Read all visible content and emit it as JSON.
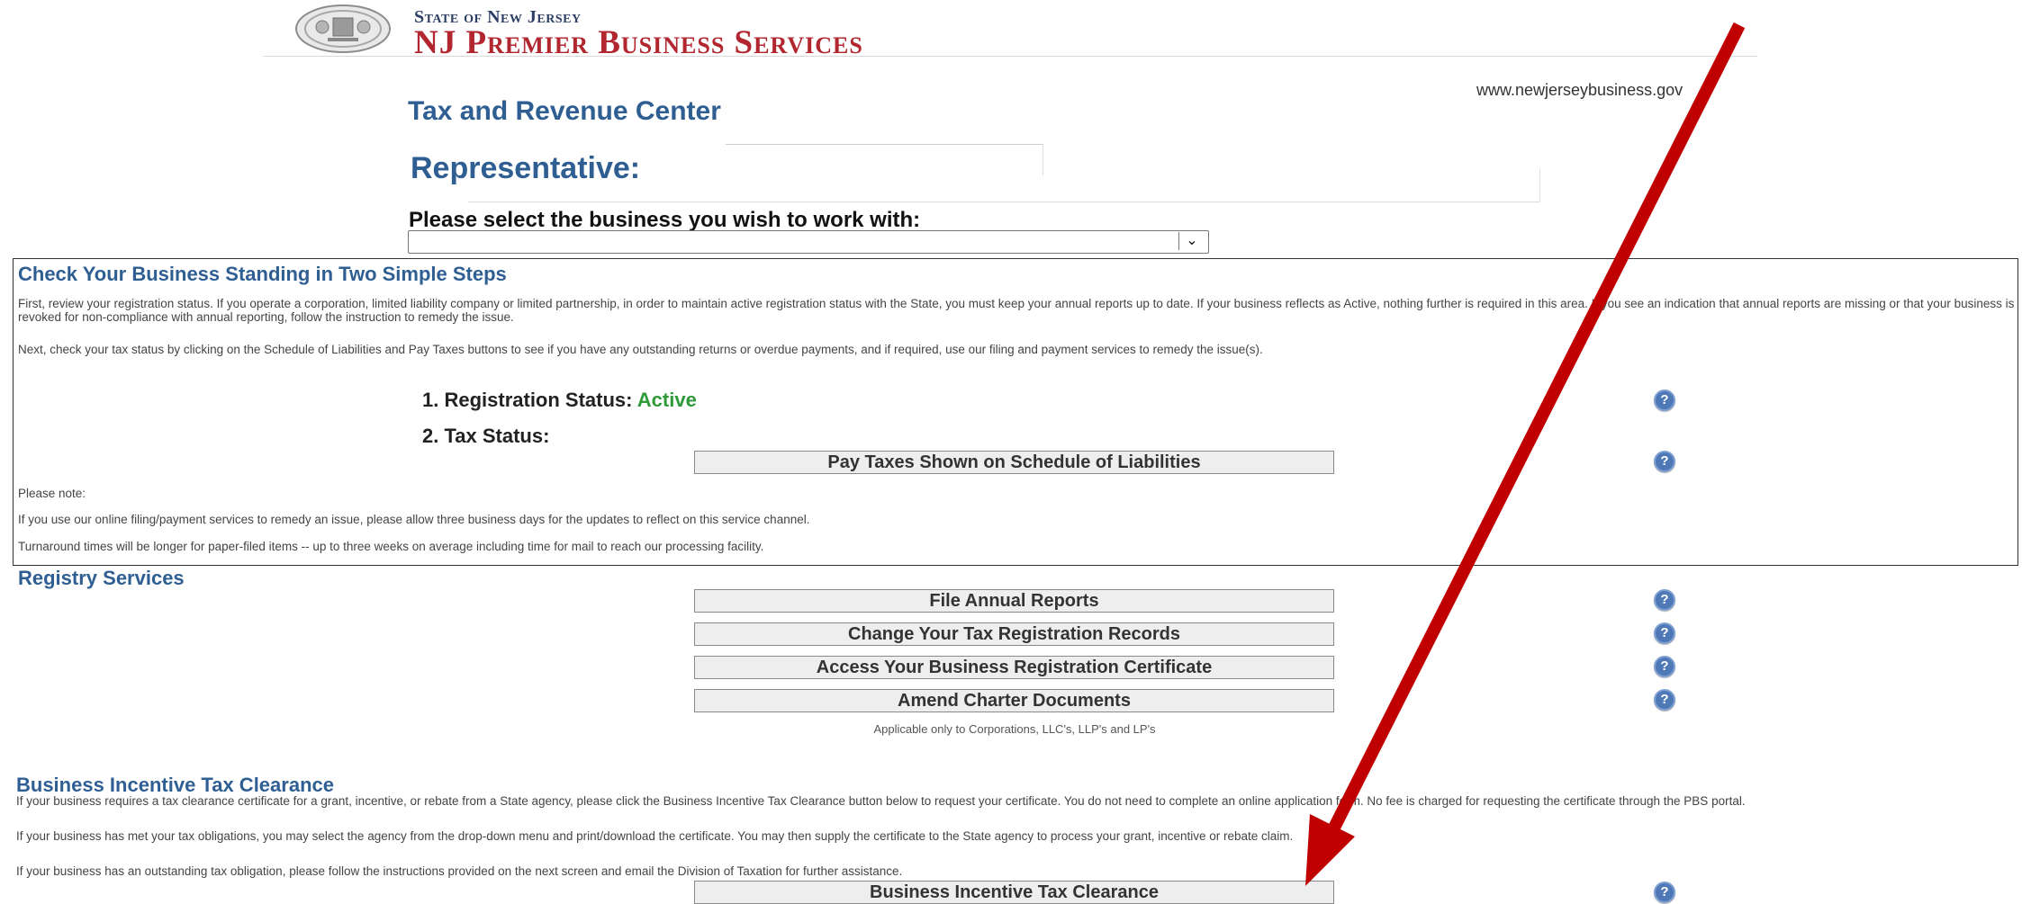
{
  "header": {
    "state_label": "State of New Jersey",
    "brand_label": "NJ Premier Business Services",
    "website": "www.newjerseybusiness.gov"
  },
  "page": {
    "title": "Tax and Revenue Center",
    "representative_label": "Representative:",
    "select_business_label": "Please select the business you wish to work with:",
    "select_value": ""
  },
  "standing": {
    "title": "Check Your Business Standing in Two Simple Steps",
    "para1": "First, review your registration status. If you operate a corporation, limited liability company or limited partnership, in order to maintain active registration status with the State, you must keep your annual reports up to date. If your business reflects as Active, nothing further is required in this area. If you see an indication that annual reports are missing or that your business is revoked for non-compliance with annual reporting, follow the instruction to remedy the issue.",
    "para2": "Next, check your tax status by clicking on the Schedule of Liabilities and Pay Taxes buttons to see if you have any outstanding returns or overdue payments, and if required, use our filing and payment services to remedy the issue(s).",
    "step1_label": "1. Registration Status:",
    "step1_value": "Active",
    "step2_label": "2. Tax Status:",
    "pay_taxes_button": "Pay Taxes Shown on Schedule of Liabilities",
    "note_heading": "Please note:",
    "note1": "If you use our online filing/payment services to remedy an issue, please allow three business days for the updates to reflect on this service channel.",
    "note2": "Turnaround times will be longer for paper-filed items -- up to three weeks on average including time for mail to reach our processing facility."
  },
  "registry": {
    "title": "Registry Services",
    "buttons": [
      "File Annual Reports",
      "Change Your Tax Registration Records",
      "Access Your Business Registration Certificate",
      "Amend Charter Documents"
    ],
    "note": "Applicable only to Corporations, LLC's, LLP's and LP's"
  },
  "clearance": {
    "title": "Business Incentive Tax Clearance",
    "para1": "If your business requires a tax clearance certificate for a grant, incentive, or rebate from a State agency, please click the Business Incentive Tax Clearance button below to request your certificate. You do not need to complete an online application form. No fee is charged for requesting the certificate through the PBS portal.",
    "para2": "If your business has met your tax obligations, you may select the agency from the drop-down menu and print/download the certificate. You may then supply the certificate to the State agency to process your grant, incentive or rebate claim.",
    "para3": "If your business has an outstanding tax obligation, please follow the instructions provided on the next screen and email the Division of Taxation for further assistance.",
    "button": "Business Incentive Tax Clearance"
  },
  "help_icon_glyph": "?",
  "colors": {
    "brand_red": "#b1262f",
    "heading_blue": "#2f5f92",
    "active_green": "#2e9a3a",
    "arrow_red": "#c00000"
  }
}
